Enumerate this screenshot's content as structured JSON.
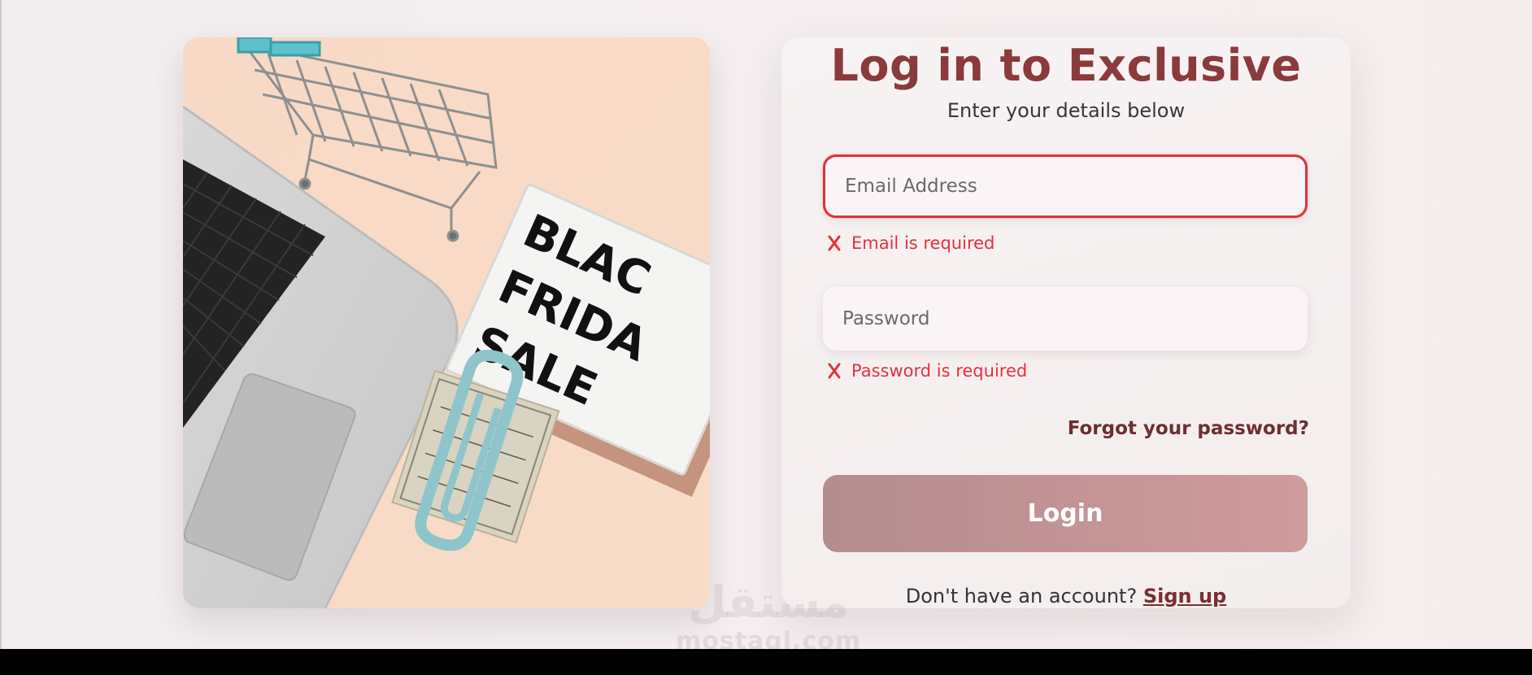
{
  "hero": {
    "sign_lines": [
      "BLAC",
      "FRIDA",
      "SALE"
    ]
  },
  "login": {
    "title": "Log in to Exclusive",
    "subtitle": "Enter your details below",
    "email": {
      "placeholder": "Email Address",
      "value": "",
      "error": "Email is required"
    },
    "password": {
      "placeholder": "Password",
      "value": "",
      "error": "Password is required"
    },
    "forgot_label": "Forgot your password?",
    "login_label": "Login",
    "signup_prompt": "Don't have an account?",
    "signup_label": "Sign up"
  },
  "watermark": {
    "logo": "مستقل",
    "site": "mostaql.com"
  },
  "colors": {
    "brand": "#8a3a3c",
    "error": "#e3323b",
    "button": "#c59497"
  }
}
